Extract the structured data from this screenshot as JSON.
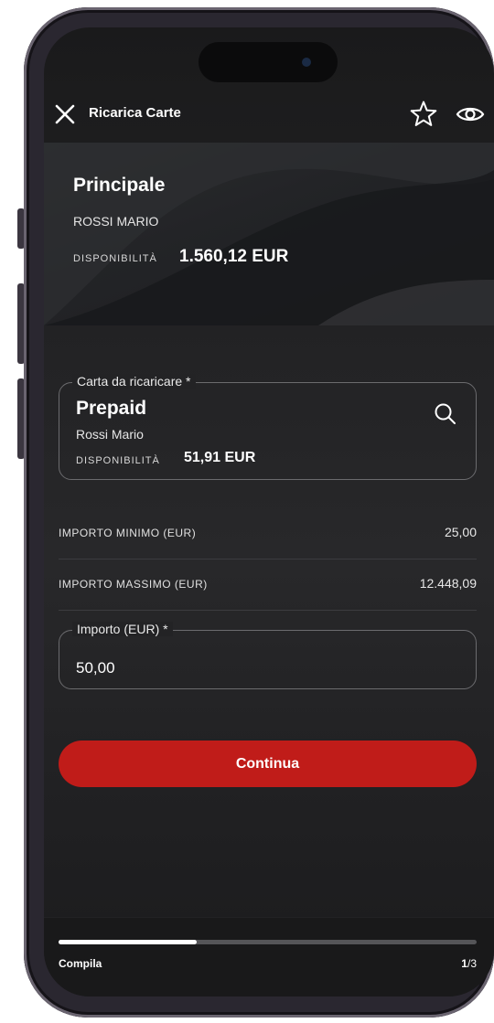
{
  "header": {
    "title": "Ricarica Carte",
    "close_icon": "close-icon",
    "favorite_icon": "star-outline-icon",
    "visibility_icon": "eye-icon"
  },
  "source_account": {
    "name": "Principale",
    "holder": "ROSSI MARIO",
    "availability_label": "DISPONIBILITÀ",
    "availability_value": "1.560,12 EUR"
  },
  "card_to_recharge": {
    "label": "Carta da ricaricare *",
    "card_name": "Prepaid",
    "holder": "Rossi Mario",
    "availability_label": "DISPONIBILITÀ",
    "availability_value": "51,91 EUR",
    "search_icon": "search-icon"
  },
  "limits": {
    "min_label": "IMPORTO MINIMO (EUR)",
    "min_value": "25,00",
    "max_label": "IMPORTO MASSIMO (EUR)",
    "max_value": "12.448,09"
  },
  "amount": {
    "label": "Importo (EUR) *",
    "value": "50,00"
  },
  "actions": {
    "continue_label": "Continua"
  },
  "progress": {
    "step_name": "Compila",
    "current_step": "1",
    "total_steps": "/3",
    "fraction": 0.33
  },
  "colors": {
    "accent": "#c01c19",
    "background": "#1f1f21"
  }
}
